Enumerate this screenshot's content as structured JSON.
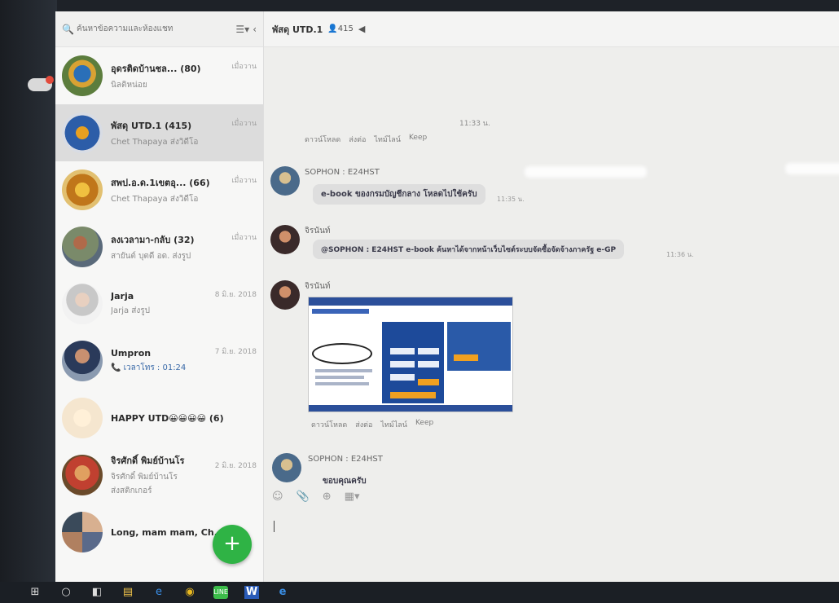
{
  "search": {
    "placeholder": "ค้นหาข้อความและห้องแชท"
  },
  "chats": [
    {
      "name": "อุดรติดบ้านชล... (80)",
      "preview": "นิลติหน่อย",
      "time": "เมื่อวาน"
    },
    {
      "name": "พัสดุ UTD.1 (415)",
      "preview": "Chet Thapaya ส่งวิดีโอ",
      "time": "เมื่อวาน"
    },
    {
      "name": "สพป.อ.ด.1เขตอุ... (66)",
      "preview": "Chet Thapaya ส่งวิดีโอ",
      "time": "เมื่อวาน"
    },
    {
      "name": "ลงเวลามา-กลับ (32)",
      "preview": "สายันต์ บุตดี อด. ส่งรูป",
      "time": "เมื่อวาน"
    },
    {
      "name": "Jarja",
      "preview": "Jarja ส่งรูป",
      "time": "8 มิ.ย. 2018"
    },
    {
      "name": "Umpron",
      "preview": "📞 เวลาโทร : 01:24",
      "time": "7 มิ.ย. 2018"
    },
    {
      "name": "HAPPY UTD😀😀😀😀 (6)",
      "preview": "",
      "time": ""
    },
    {
      "name": "จิรศักดิ์ พิมย์บ้านโร",
      "preview": "จิรศักดิ์ พิมย์บ้านโร",
      "preview2": "ส่งสติกเกอร์",
      "time": "2 มิ.ย. 2018"
    },
    {
      "name": "Long, mam mam, Ch...",
      "preview": "",
      "time": ""
    }
  ],
  "fab_label": "+",
  "header": {
    "title": "พัสดุ UTD.1",
    "members": "👤415",
    "speaker": "◀"
  },
  "messages": {
    "top_time": "11:33 น.",
    "top_actions": [
      "ดาวน์โหลด",
      "ส่งต่อ",
      "ไทม์ไลน์",
      "Keep"
    ],
    "m1_sender": "SOPHON : E24HST",
    "m1_text": "e-book ของกรมบัญชีกลาง โหลดไปใช้ครับ",
    "m1_time": "11:35 น.",
    "m2_sender": "จิรนันท์",
    "m2_text": "@SOPHON : E24HST e-book ค้นหาได้จากหน้าเว็บไซต์ระบบจัดซื้อจัดจ้างภาครัฐ e-GP",
    "m2_time": "11:36 น.",
    "m3_sender": "จิรนันท์",
    "m3_actions": [
      "ดาวน์โหลด",
      "ส่งต่อ",
      "ไทม์ไลน์",
      "Keep"
    ],
    "m4_sender": "SOPHON : E24HST",
    "m4_text": "ขอบคุณครับ"
  },
  "composer_icons": [
    "emoji-icon",
    "attach-icon",
    "screenshot-icon",
    "more-icon"
  ],
  "taskbar_icons": [
    "windows-icon",
    "search-icon",
    "taskview-icon",
    "explorer-icon",
    "edge-icon",
    "chrome-icon",
    "line-icon",
    "word-icon",
    "ie-icon"
  ]
}
